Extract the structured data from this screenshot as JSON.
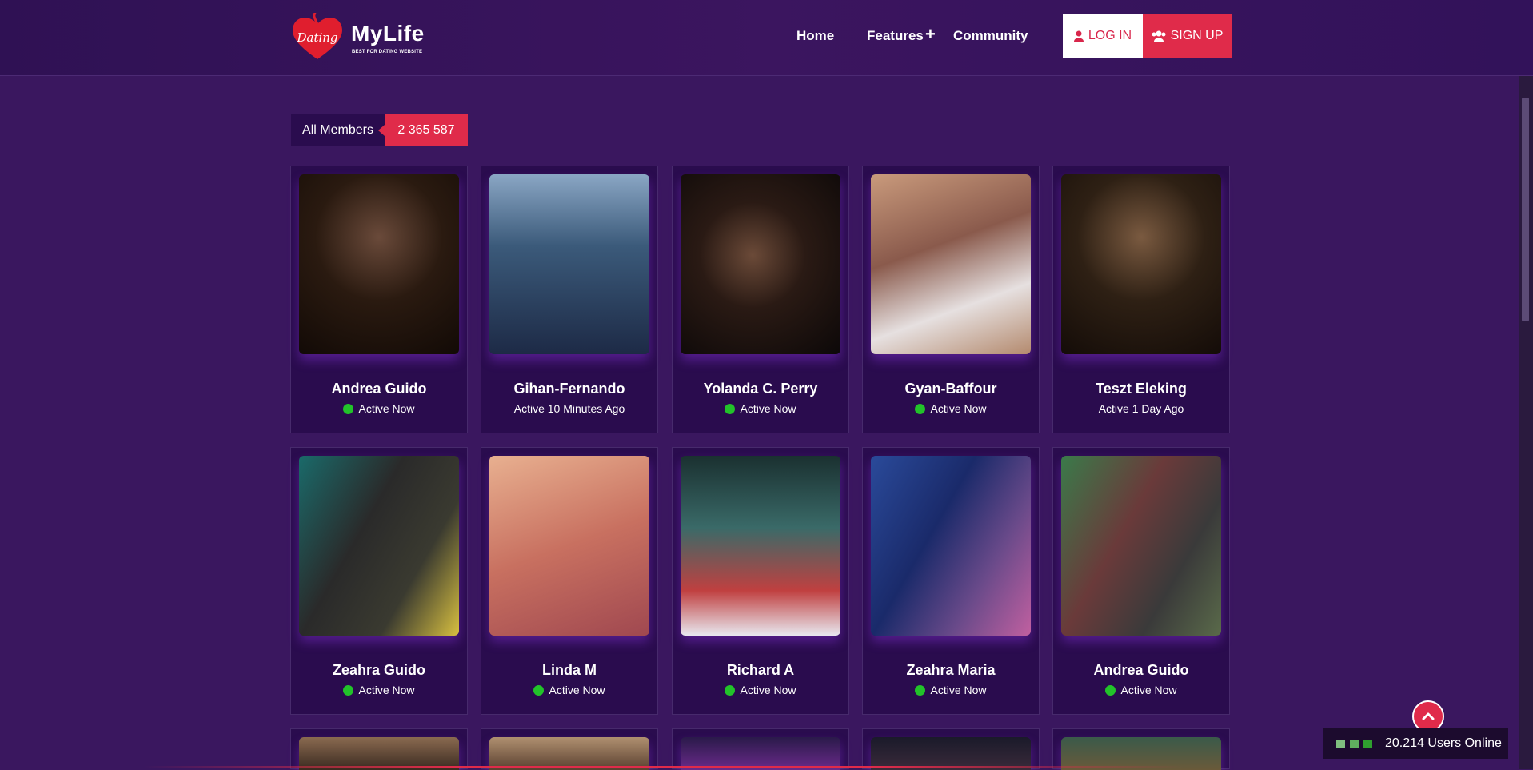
{
  "brand": {
    "name": "MyLife",
    "logo_script": "Dating",
    "tagline": "BEST FOR DATING WEBSITE"
  },
  "nav": {
    "home": "Home",
    "features": "Features",
    "features_icon": "+",
    "community": "Community"
  },
  "auth": {
    "login": "LOG IN",
    "signup": "SIGN UP",
    "login_icon": "user-icon",
    "signup_icon": "users-icon"
  },
  "members": {
    "label": "All Members",
    "count": "2 365 587"
  },
  "profiles": [
    {
      "name": "Andrea Guido",
      "status": "Active Now",
      "online": true
    },
    {
      "name": "Gihan-Fernando",
      "status": "Active 10 Minutes Ago",
      "online": false
    },
    {
      "name": "Yolanda C. Perry",
      "status": "Active Now",
      "online": true
    },
    {
      "name": "Gyan-Baffour",
      "status": "Active Now",
      "online": true
    },
    {
      "name": "Teszt Eleking",
      "status": "Active 1 Day Ago",
      "online": false
    },
    {
      "name": "Zeahra Guido",
      "status": "Active Now",
      "online": true
    },
    {
      "name": "Linda M",
      "status": "Active Now",
      "online": true
    },
    {
      "name": "Richard A",
      "status": "Active Now",
      "online": true
    },
    {
      "name": "Zeahra Maria",
      "status": "Active Now",
      "online": true
    },
    {
      "name": "Andrea Guido",
      "status": "Active Now",
      "online": true
    }
  ],
  "online_widget": {
    "text": "20.214 Users Online"
  },
  "colors": {
    "accent": "#e02b4a",
    "background": "#3a175f",
    "card": "#2a0c4e",
    "online_dot": "#22c32a"
  }
}
